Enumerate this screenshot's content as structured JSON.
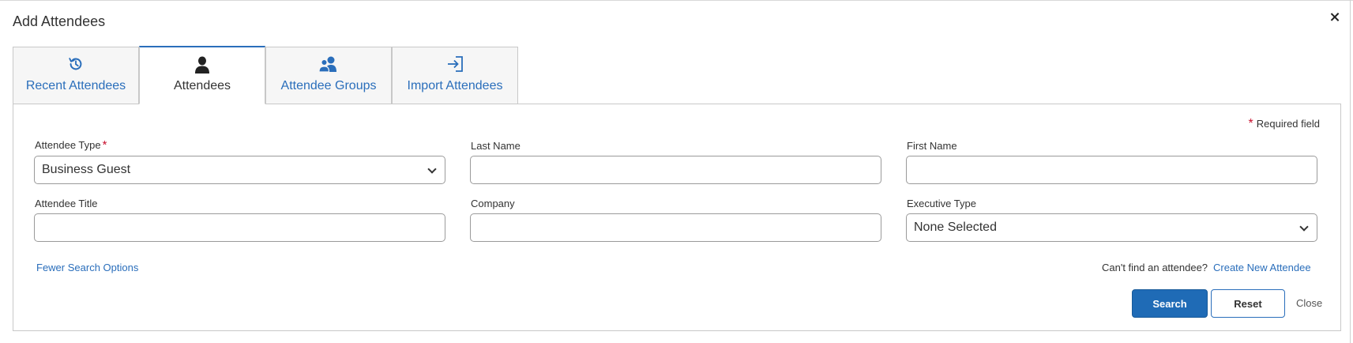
{
  "dialog": {
    "title": "Add Attendees"
  },
  "tabs": [
    {
      "label": "Recent Attendees",
      "icon": "history-icon"
    },
    {
      "label": "Attendees",
      "icon": "person-icon"
    },
    {
      "label": "Attendee Groups",
      "icon": "group-icon"
    },
    {
      "label": "Import Attendees",
      "icon": "import-icon"
    }
  ],
  "form": {
    "required_note": "Required field",
    "attendee_type": {
      "label": "Attendee Type",
      "value": "Business Guest"
    },
    "last_name": {
      "label": "Last Name",
      "value": ""
    },
    "first_name": {
      "label": "First Name",
      "value": ""
    },
    "attendee_title": {
      "label": "Attendee Title",
      "value": ""
    },
    "company": {
      "label": "Company",
      "value": ""
    },
    "executive_type": {
      "label": "Executive Type",
      "value": "None Selected"
    }
  },
  "links": {
    "fewer_options": "Fewer Search Options",
    "cant_find": "Can't find an attendee?",
    "create_new": "Create New Attendee"
  },
  "buttons": {
    "search": "Search",
    "reset": "Reset",
    "close": "Close"
  },
  "colors": {
    "accent": "#2a6ebb",
    "primary_button": "#1f6bb6",
    "required_star": "#c8102e"
  }
}
